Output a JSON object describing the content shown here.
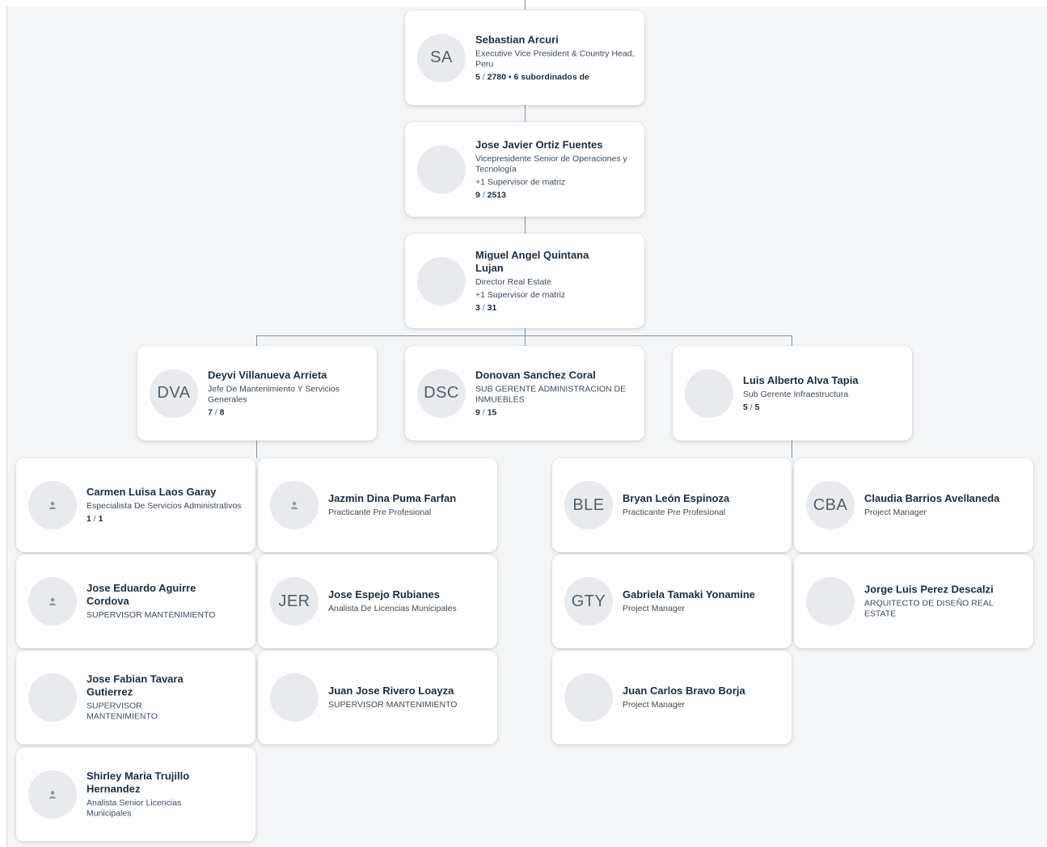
{
  "colors": {
    "connector": "#7a93a8",
    "card_bg": "#ffffff",
    "canvas_bg": "#f5f6f7",
    "avatar_bg": "#e8eaed"
  },
  "cards": {
    "c1": {
      "initials": "SA",
      "name": "Sebastian Arcuri",
      "title": "Executive Vice President & Country Head, Peru",
      "direct": "5",
      "total": "2780",
      "sub": "• 6 subordinados de"
    },
    "c2": {
      "initials": "",
      "name": "Jose Javier Ortiz Fuentes",
      "title": "Vicepresidente Senior de Operaciones y Tecnología",
      "extra": "+1 Supervisor de matriz",
      "direct": "9",
      "total": "2513"
    },
    "c3": {
      "initials": "",
      "name": "Miguel Angel Quintana Lujan",
      "title": "Director Real Estate",
      "extra": "+1 Supervisor de matriz",
      "direct": "3",
      "total": "31"
    },
    "c4": {
      "initials": "DVA",
      "name": "Deyvi Villanueva Arrieta",
      "title": "Jefe De Mantenimiento Y Servicios Generales",
      "direct": "7",
      "total": "8"
    },
    "c5": {
      "initials": "DSC",
      "name": "Donovan Sanchez Coral",
      "title": "SUB GERENTE ADMINISTRACION DE INMUEBLES",
      "direct": "9",
      "total": "15"
    },
    "c6": {
      "initials": "",
      "name": "Luis Alberto Alva Tapia",
      "title": "Sub Gerente Infraestructura",
      "direct": "5",
      "total": "5"
    },
    "c7": {
      "initials": "",
      "name": "Carmen Luisa Laos Garay",
      "title": "Especialista De Servicios Administrativos",
      "direct": "1",
      "total": "1"
    },
    "c8": {
      "initials": "",
      "name": "Jazmin Dina Puma Farfan",
      "title": "Practicante Pre Profesional"
    },
    "c9": {
      "initials": "",
      "name": "Jose Eduardo Aguirre Cordova",
      "title": "SUPERVISOR MANTENIMIENTO"
    },
    "c10": {
      "initials": "JER",
      "name": "Jose Espejo Rubianes",
      "title": "Analista De Licencias Municipales"
    },
    "c11": {
      "initials": "",
      "name": "Jose Fabian Tavara Gutierrez",
      "title": "SUPERVISOR MANTENIMIENTO"
    },
    "c12": {
      "initials": "",
      "name": "Juan Jose Rivero Loayza",
      "title": "SUPERVISOR MANTENIMIENTO"
    },
    "c13": {
      "initials": "",
      "name": "Shirley Maria Trujillo Hernandez",
      "title": "Analista Senior Licencias Municipales"
    },
    "c14": {
      "initials": "BLE",
      "name": "Bryan León Espinoza",
      "title": "Practicante Pre Profesional"
    },
    "c15": {
      "initials": "CBA",
      "name": "Claudia Barrios Avellaneda",
      "title": "Project Manager"
    },
    "c16": {
      "initials": "GTY",
      "name": "Gabriela Tamaki Yonamine",
      "title": "Project Manager"
    },
    "c17": {
      "initials": "",
      "name": "Jorge Luis Perez Descalzi",
      "title": "ARQUITECTO DE DISEÑO REAL ESTATE"
    },
    "c18": {
      "initials": "",
      "name": "Juan Carlos Bravo Borja",
      "title": "Project Manager"
    }
  }
}
